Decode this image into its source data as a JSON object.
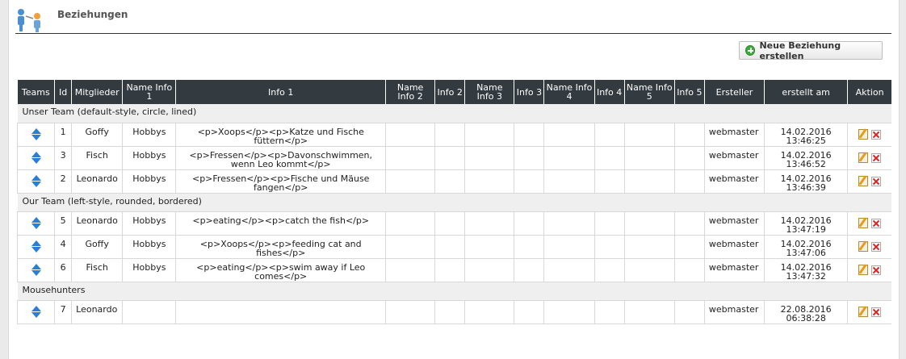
{
  "header": {
    "title": "Beziehungen",
    "icon": "relationship-icon"
  },
  "actions": {
    "new_label": "Neue Beziehung erstellen",
    "new_icon": "plus-circle-icon"
  },
  "columns": [
    "Teams",
    "Id",
    "Mitglieder",
    "Name Info 1",
    "Info 1",
    "Name Info 2",
    "Info 2",
    "Name Info 3",
    "Info 3",
    "Name Info 4",
    "Info 4",
    "Name Info 5",
    "Info 5",
    "Ersteller",
    "erstellt am",
    "Aktion"
  ],
  "groups": [
    {
      "name": "Unser Team (default-style, circle, lined)",
      "rows": [
        {
          "id": "1",
          "member": "Goffy",
          "name_info1": "Hobbys",
          "info1": "<p>Xoops</p><p>Katze und Fische füttern</p>",
          "creator": "webmaster",
          "date": "14.02.2016",
          "time": "13:46:25"
        },
        {
          "id": "3",
          "member": "Fisch",
          "name_info1": "Hobbys",
          "info1": "<p>Fressen</p><p>Davonschwimmen, wenn Leo kommt</p>",
          "creator": "webmaster",
          "date": "14.02.2016",
          "time": "13:46:52"
        },
        {
          "id": "2",
          "member": "Leonardo",
          "name_info1": "Hobbys",
          "info1": "<p>Fressen</p><p>Fische und Mäuse fangen</p>",
          "creator": "webmaster",
          "date": "14.02.2016",
          "time": "13:46:39"
        }
      ]
    },
    {
      "name": "Our Team (left-style, rounded, bordered)",
      "rows": [
        {
          "id": "5",
          "member": "Leonardo",
          "name_info1": "Hobbys",
          "info1": "<p>eating</p><p>catch the fish</p>",
          "creator": "webmaster",
          "date": "14.02.2016",
          "time": "13:47:19"
        },
        {
          "id": "4",
          "member": "Goffy",
          "name_info1": "Hobbys",
          "info1": "<p>Xoops</p><p>feeding cat and fishes</p>",
          "creator": "webmaster",
          "date": "14.02.2016",
          "time": "13:47:06"
        },
        {
          "id": "6",
          "member": "Fisch",
          "name_info1": "Hobbys",
          "info1": "<p>eating</p><p>swim away if Leo comes</p>",
          "creator": "webmaster",
          "date": "14.02.2016",
          "time": "13:47:32"
        }
      ]
    },
    {
      "name": "Mousehunters",
      "rows": [
        {
          "id": "7",
          "member": "Leonardo",
          "name_info1": "",
          "info1": "",
          "creator": "webmaster",
          "date": "22.08.2016",
          "time": "06:38:28"
        }
      ]
    }
  ]
}
